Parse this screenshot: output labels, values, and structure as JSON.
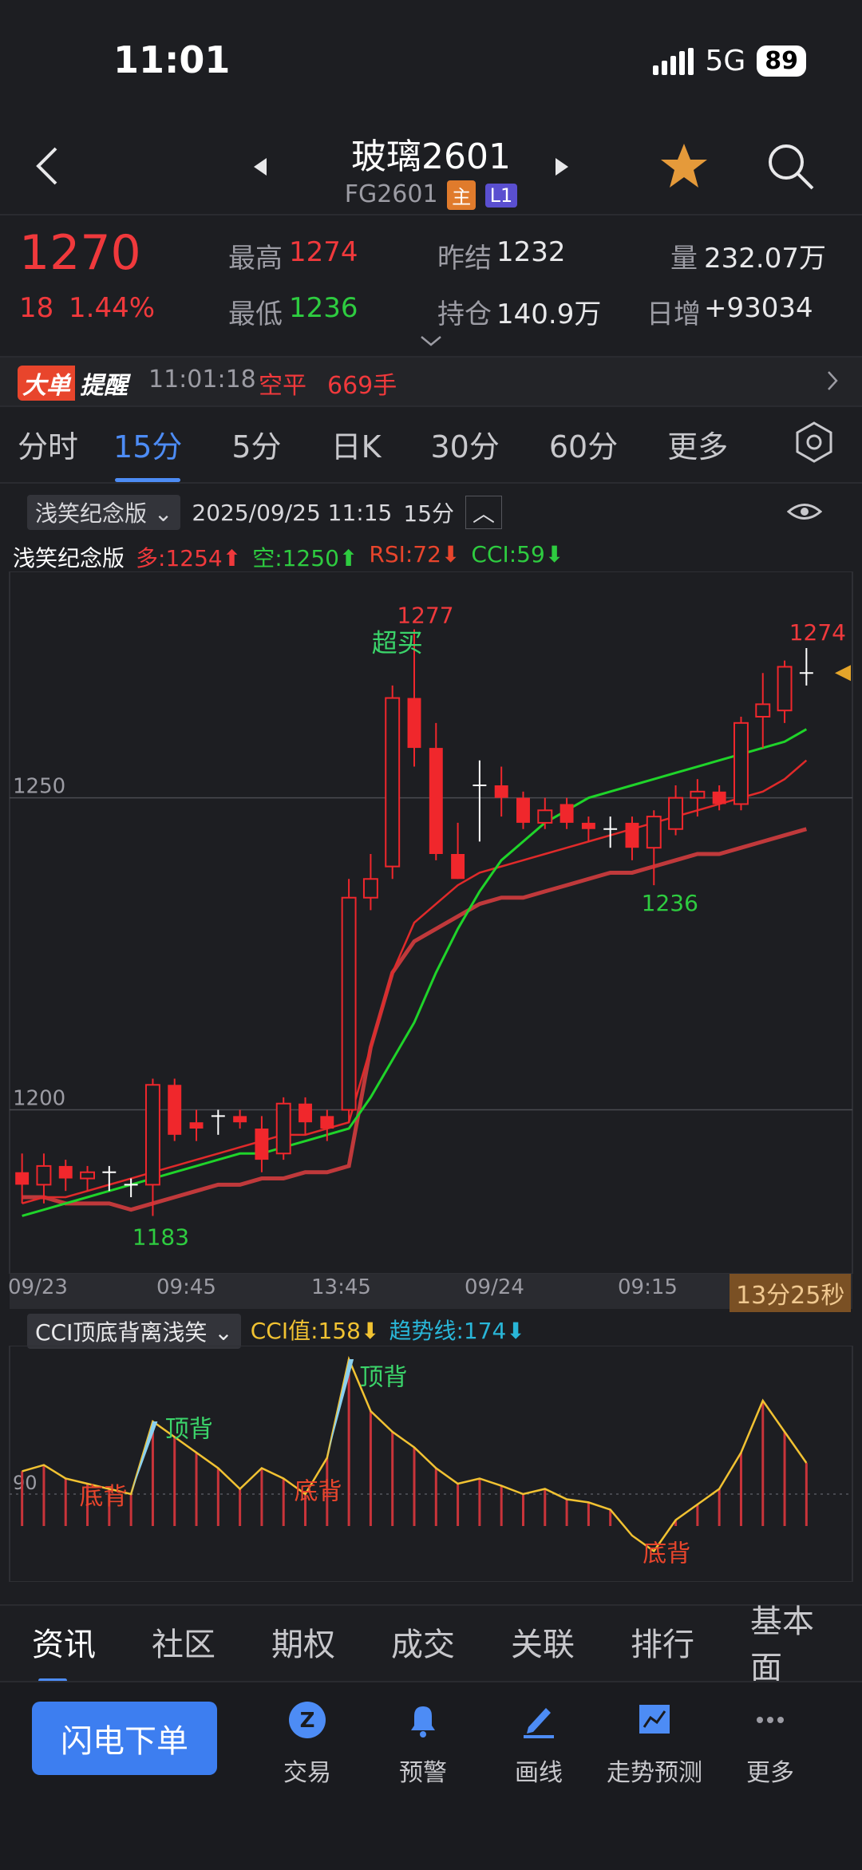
{
  "status": {
    "time": "11:01",
    "network": "5G",
    "battery": "89"
  },
  "header": {
    "title": "玻璃2601",
    "code": "FG2601",
    "tag_main": "主",
    "tag_level": "L1"
  },
  "quote": {
    "price": "1270",
    "change": "18",
    "change_pct": "1.44%",
    "high_label": "最高",
    "high": "1274",
    "low_label": "最低",
    "low": "1236",
    "prev_label": "昨结",
    "prev": "1232",
    "oi_label": "持仓",
    "oi": "140.9万",
    "vol_label": "量",
    "vol": "232.07万",
    "day_inc_label": "日增",
    "day_inc": "+93034"
  },
  "alert": {
    "badge1": "大单",
    "badge2": "提醒",
    "time": "11:01:18",
    "type": "空平",
    "qty": "669手"
  },
  "tabs": [
    "分时",
    "15分",
    "5分",
    "日K",
    "30分",
    "60分",
    "更多"
  ],
  "active_tab": "15分",
  "chart_header": {
    "indicator": "浅笑纪念版",
    "datetime": "2025/09/25 11:15",
    "period": "15分"
  },
  "indicator_line": {
    "name": "浅笑纪念版",
    "long": "多:1254",
    "short": "空:1250",
    "rsi": "RSI:72",
    "cci": "CCI:59"
  },
  "main_chart": {
    "y_labels": [
      "1250",
      "1200"
    ],
    "annotations": {
      "overbought": "超买",
      "peak": "1277",
      "last_high": "1274",
      "mid_low": "1236",
      "low": "1183"
    },
    "x_labels": [
      "09/23",
      "09:45",
      "13:45",
      "09/24",
      "09:15"
    ],
    "countdown": "13分25秒"
  },
  "sub_chart": {
    "name": "CCI顶底背离浅笑",
    "cci": "CCI值:158",
    "trend": "趋势线:174",
    "y_label": "90",
    "top_div": "顶背",
    "bottom_div": "底背"
  },
  "info_tabs": [
    "资讯",
    "社区",
    "期权",
    "成交",
    "关联",
    "排行",
    "基本面"
  ],
  "bottom_nav": {
    "order": "闪电下单",
    "items": [
      "交易",
      "预警",
      "画线",
      "走势预测",
      "更多"
    ]
  },
  "chart_data": {
    "type": "candlestick",
    "candles": [
      {
        "o": 1190,
        "h": 1193,
        "l": 1185,
        "c": 1188
      },
      {
        "o": 1188,
        "h": 1193,
        "l": 1185,
        "c": 1191
      },
      {
        "o": 1191,
        "h": 1192,
        "l": 1187,
        "c": 1189
      },
      {
        "o": 1189,
        "h": 1191,
        "l": 1187,
        "c": 1190
      },
      {
        "o": 1190,
        "h": 1191,
        "l": 1187,
        "c": 1190
      },
      {
        "o": 1188,
        "h": 1189,
        "l": 1186,
        "c": 1188
      },
      {
        "o": 1188,
        "h": 1205,
        "l": 1183,
        "c": 1204
      },
      {
        "o": 1204,
        "h": 1205,
        "l": 1195,
        "c": 1196
      },
      {
        "o": 1198,
        "h": 1200,
        "l": 1195,
        "c": 1197
      },
      {
        "o": 1199,
        "h": 1200,
        "l": 1196,
        "c": 1199
      },
      {
        "o": 1199,
        "h": 1200,
        "l": 1197,
        "c": 1198
      },
      {
        "o": 1197,
        "h": 1199,
        "l": 1190,
        "c": 1192
      },
      {
        "o": 1193,
        "h": 1202,
        "l": 1192,
        "c": 1201
      },
      {
        "o": 1201,
        "h": 1202,
        "l": 1196,
        "c": 1198
      },
      {
        "o": 1199,
        "h": 1200,
        "l": 1195,
        "c": 1197
      },
      {
        "o": 1200,
        "h": 1237,
        "l": 1198,
        "c": 1234
      },
      {
        "o": 1234,
        "h": 1241,
        "l": 1232,
        "c": 1237
      },
      {
        "o": 1239,
        "h": 1268,
        "l": 1237,
        "c": 1266
      },
      {
        "o": 1266,
        "h": 1277,
        "l": 1255,
        "c": 1258
      },
      {
        "o": 1258,
        "h": 1262,
        "l": 1240,
        "c": 1241
      },
      {
        "o": 1241,
        "h": 1246,
        "l": 1237,
        "c": 1237
      },
      {
        "o": 1252,
        "h": 1256,
        "l": 1243,
        "c": 1252
      },
      {
        "o": 1252,
        "h": 1255,
        "l": 1247,
        "c": 1250
      },
      {
        "o": 1250,
        "h": 1251,
        "l": 1245,
        "c": 1246
      },
      {
        "o": 1246,
        "h": 1250,
        "l": 1245,
        "c": 1248
      },
      {
        "o": 1249,
        "h": 1250,
        "l": 1245,
        "c": 1246
      },
      {
        "o": 1246,
        "h": 1247,
        "l": 1243,
        "c": 1245
      },
      {
        "o": 1245,
        "h": 1247,
        "l": 1242,
        "c": 1245
      },
      {
        "o": 1246,
        "h": 1247,
        "l": 1240,
        "c": 1242
      },
      {
        "o": 1242,
        "h": 1248,
        "l": 1236,
        "c": 1247
      },
      {
        "o": 1245,
        "h": 1252,
        "l": 1244,
        "c": 1250
      },
      {
        "o": 1250,
        "h": 1253,
        "l": 1247,
        "c": 1251
      },
      {
        "o": 1251,
        "h": 1252,
        "l": 1248,
        "c": 1249
      },
      {
        "o": 1249,
        "h": 1263,
        "l": 1248,
        "c": 1262
      },
      {
        "o": 1263,
        "h": 1270,
        "l": 1258,
        "c": 1265
      },
      {
        "o": 1264,
        "h": 1272,
        "l": 1262,
        "c": 1271
      },
      {
        "o": 1270,
        "h": 1274,
        "l": 1268,
        "c": 1270
      }
    ],
    "ma_green": [
      1183,
      1184,
      1185,
      1186,
      1187,
      1188,
      1189,
      1190,
      1191,
      1192,
      1193,
      1193,
      1194,
      1195,
      1196,
      1197,
      1202,
      1208,
      1214,
      1222,
      1229,
      1235,
      1240,
      1243,
      1246,
      1248,
      1250,
      1251,
      1252,
      1253,
      1254,
      1255,
      1256,
      1257,
      1258,
      1259,
      1261
    ],
    "ma_red": [
      1185,
      1186,
      1186,
      1187,
      1188,
      1189,
      1190,
      1191,
      1192,
      1193,
      1194,
      1195,
      1196,
      1196,
      1197,
      1198,
      1210,
      1222,
      1230,
      1233,
      1236,
      1238,
      1239,
      1240,
      1241,
      1242,
      1243,
      1244,
      1245,
      1246,
      1247,
      1248,
      1249,
      1250,
      1251,
      1253,
      1256
    ],
    "ma_thick": [
      1186,
      1186,
      1185,
      1185,
      1185,
      1184,
      1185,
      1186,
      1187,
      1188,
      1188,
      1189,
      1189,
      1190,
      1190,
      1191,
      1210,
      1222,
      1227,
      1229,
      1231,
      1233,
      1234,
      1234,
      1235,
      1236,
      1237,
      1238,
      1238,
      1239,
      1240,
      1241,
      1241,
      1242,
      1243,
      1244,
      1245
    ],
    "cci": [
      22,
      28,
      15,
      10,
      5,
      0,
      70,
      55,
      40,
      25,
      5,
      25,
      15,
      0,
      35,
      130,
      80,
      60,
      45,
      25,
      10,
      15,
      8,
      0,
      5,
      -5,
      -8,
      -15,
      -40,
      -55,
      -25,
      -10,
      5,
      40,
      90,
      60,
      30
    ],
    "y_range": [
      1175,
      1285
    ]
  }
}
